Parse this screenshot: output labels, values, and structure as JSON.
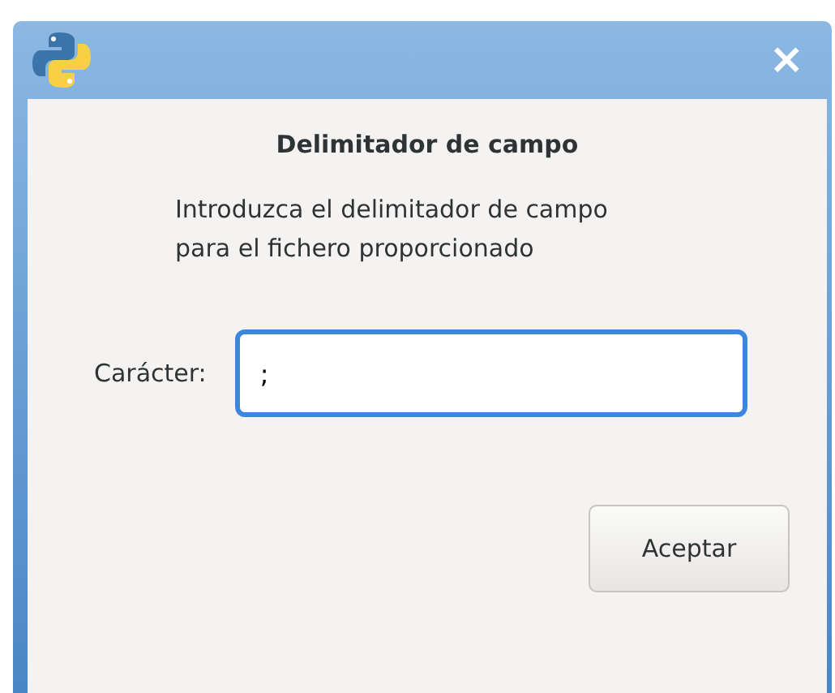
{
  "window": {
    "close_label": "×"
  },
  "dialog": {
    "heading": "Delimitador de campo",
    "message": "Introduzca el delimitador de campo para el fichero proporcionado"
  },
  "field": {
    "label": "Carácter:",
    "value": ";",
    "focused": true
  },
  "buttons": [
    "Aceptar"
  ]
}
